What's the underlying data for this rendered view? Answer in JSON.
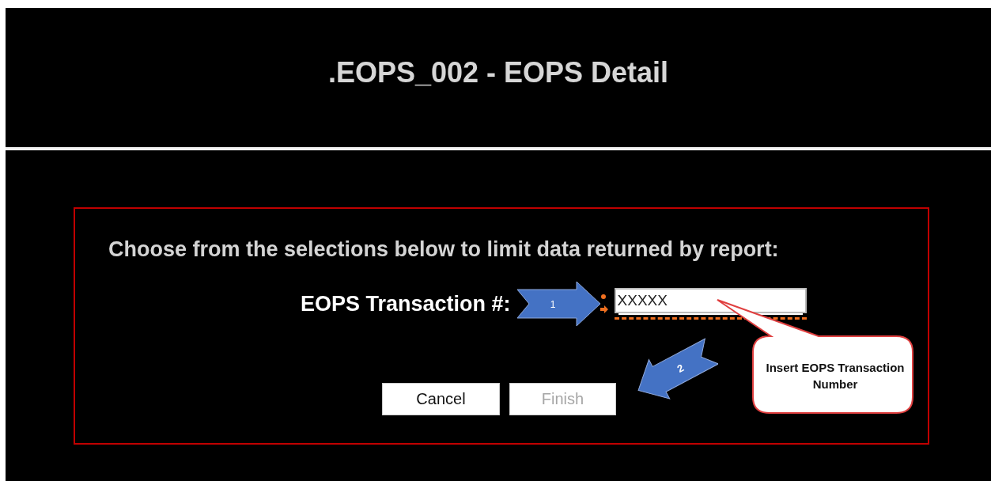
{
  "title": ".EOPS_002 - EOPS Detail",
  "prompt": "Choose from the selections below to limit data returned by report:",
  "field": {
    "label": "EOPS Transaction #:",
    "value": "XXXXX",
    "required": true
  },
  "buttons": [
    {
      "label": "Cancel",
      "disabled": false
    },
    {
      "label": "Finish",
      "disabled": true
    }
  ],
  "annotations": [
    {
      "kind": "arrow",
      "number": "1"
    },
    {
      "kind": "arrow",
      "number": "2"
    },
    {
      "kind": "callout",
      "text": "Insert EOPS Transaction Number"
    }
  ]
}
